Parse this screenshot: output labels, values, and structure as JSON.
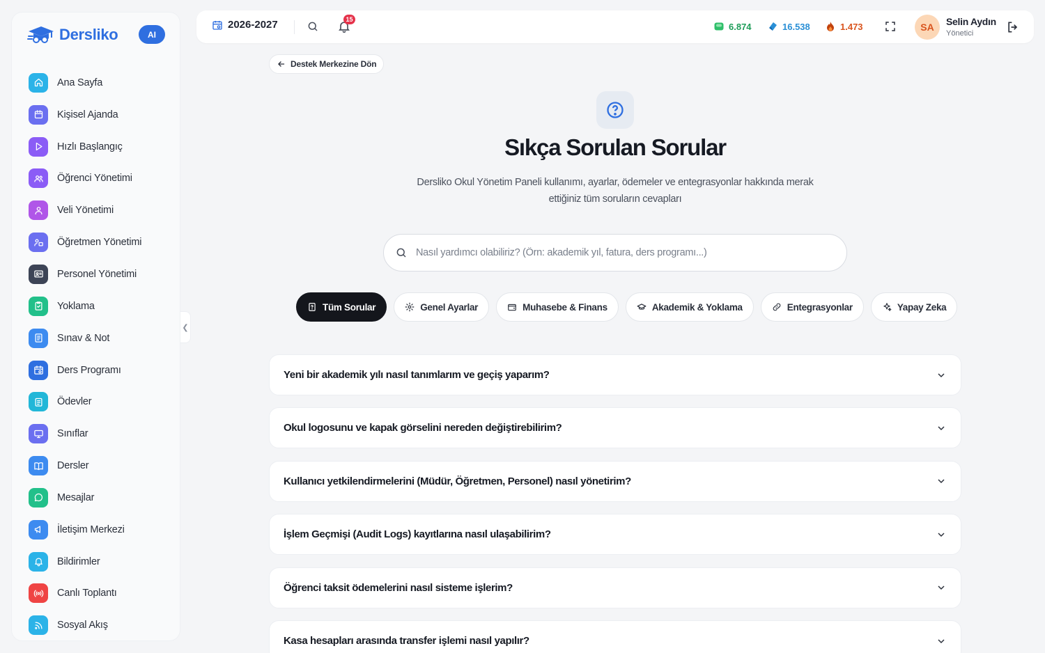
{
  "brand": {
    "name": "Dersliko",
    "ai_badge": "AI"
  },
  "sidebar": {
    "items": [
      {
        "label": "Ana Sayfa",
        "icon": "home-icon",
        "color": "#2bb3e8"
      },
      {
        "label": "Kişisel Ajanda",
        "icon": "calendar-icon",
        "color": "#6b6ff0"
      },
      {
        "label": "Hızlı Başlangıç",
        "icon": "play-icon",
        "color": "#8b5cf6"
      },
      {
        "label": "Öğrenci Yönetimi",
        "icon": "users-icon",
        "color": "#8b5cf6"
      },
      {
        "label": "Veli Yönetimi",
        "icon": "user-group-icon",
        "color": "#b056e8"
      },
      {
        "label": "Öğretmen Yönetimi",
        "icon": "teacher-icon",
        "color": "#6b6ff0"
      },
      {
        "label": "Personel Yönetimi",
        "icon": "id-card-icon",
        "color": "#3d4456"
      },
      {
        "label": "Yoklama",
        "icon": "clipboard-check-icon",
        "color": "#22c08a"
      },
      {
        "label": "Sınav & Not",
        "icon": "document-icon",
        "color": "#3d8bf0"
      },
      {
        "label": "Ders Programı",
        "icon": "calendar-clock-icon",
        "color": "#2f6fe0"
      },
      {
        "label": "Ödevler",
        "icon": "clipboard-list-icon",
        "color": "#22b7d8"
      },
      {
        "label": "Sınıflar",
        "icon": "monitor-icon",
        "color": "#6b6ff0"
      },
      {
        "label": "Dersler",
        "icon": "book-open-icon",
        "color": "#3d8bf0"
      },
      {
        "label": "Mesajlar",
        "icon": "chat-icon",
        "color": "#22c08a"
      },
      {
        "label": "İletişim Merkezi",
        "icon": "megaphone-icon",
        "color": "#3d8bf0"
      },
      {
        "label": "Bildirimler",
        "icon": "bell-icon",
        "color": "#2bb3e8"
      },
      {
        "label": "Canlı Toplantı",
        "icon": "broadcast-icon",
        "color": "#ef4444"
      },
      {
        "label": "Sosyal Akış",
        "icon": "rss-icon",
        "color": "#2bb3e8"
      }
    ]
  },
  "topbar": {
    "year": "2026-2027",
    "notification_count": "15",
    "stats": [
      {
        "value": "6.874",
        "color": "#1f9d5a",
        "icon": "green-gem-icon"
      },
      {
        "value": "16.538",
        "color": "#2a8fd6",
        "icon": "blue-gem-icon"
      },
      {
        "value": "1.473",
        "color": "#d9541e",
        "icon": "fire-icon"
      }
    ],
    "user": {
      "initials": "SA",
      "name": "Selin Aydın",
      "role": "Yönetici"
    }
  },
  "main": {
    "back_label": "Destek Merkezine Dön",
    "title": "Sıkça Sorulan Sorular",
    "subtitle": "Dersliko Okul Yönetim Paneli kullanımı, ayarlar, ödemeler ve entegrasyonlar hakkında merak ettiğiniz tüm soruların cevapları",
    "search_placeholder": "Nasıl yardımcı olabiliriz? (Örn: akademik yıl, fatura, ders programı...)",
    "tabs": [
      {
        "label": "Tüm Sorular",
        "icon": "file-question-icon",
        "active": true
      },
      {
        "label": "Genel Ayarlar",
        "icon": "gear-icon",
        "active": false
      },
      {
        "label": "Muhasebe & Finans",
        "icon": "wallet-icon",
        "active": false
      },
      {
        "label": "Akademik & Yoklama",
        "icon": "graduation-cap-icon",
        "active": false
      },
      {
        "label": "Entegrasyonlar",
        "icon": "link-icon",
        "active": false
      },
      {
        "label": "Yapay Zeka",
        "icon": "sparkles-icon",
        "active": false
      }
    ],
    "faqs": [
      "Yeni bir akademik yılı nasıl tanımlarım ve geçiş yaparım?",
      "Okul logosunu ve kapak görselini nereden değiştirebilirim?",
      "Kullanıcı yetkilendirmelerini (Müdür, Öğretmen, Personel) nasıl yönetirim?",
      "İşlem Geçmişi (Audit Logs) kayıtlarına nasıl ulaşabilirim?",
      "Öğrenci taksit ödemelerini nasıl sisteme işlerim?",
      "Kasa hesapları arasında transfer işlemi nasıl yapılır?"
    ]
  }
}
